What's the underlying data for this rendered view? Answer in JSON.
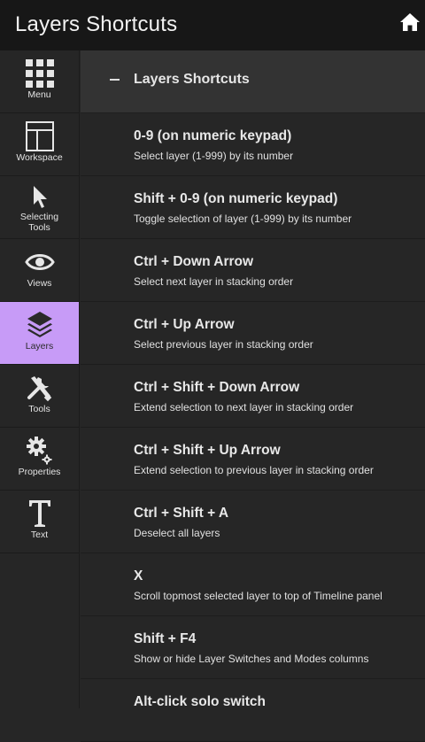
{
  "header": {
    "title": "Layers Shortcuts",
    "home_icon": "home-icon"
  },
  "sidebar": {
    "items": [
      {
        "label": "Menu",
        "icon": "grid-icon",
        "active": false
      },
      {
        "label": "Workspace",
        "icon": "workspace-icon",
        "active": false
      },
      {
        "label": "Selecting Tools",
        "icon": "pointer-icon",
        "active": false
      },
      {
        "label": "Views",
        "icon": "eye-icon",
        "active": false
      },
      {
        "label": "Layers",
        "icon": "layers-icon",
        "active": true
      },
      {
        "label": "Tools",
        "icon": "tools-icon",
        "active": false
      },
      {
        "label": "Properties",
        "icon": "gears-icon",
        "active": false
      },
      {
        "label": "Text",
        "icon": "text-icon",
        "active": false
      }
    ]
  },
  "section": {
    "title": "Layers Shortcuts"
  },
  "shortcuts": [
    {
      "key": "0-9 (on numeric keypad)",
      "desc": "Select layer (1-999) by its number"
    },
    {
      "key": "Shift + 0-9 (on numeric keypad)",
      "desc": "Toggle selection of layer (1-999) by its number"
    },
    {
      "key": "Ctrl + Down Arrow",
      "desc": "Select next layer in stacking order"
    },
    {
      "key": "Ctrl + Up Arrow",
      "desc": "Select previous layer in stacking order"
    },
    {
      "key": "Ctrl + Shift + Down Arrow",
      "desc": "Extend selection to next layer in stacking order"
    },
    {
      "key": "Ctrl + Shift + Up Arrow",
      "desc": "Extend selection to previous layer in stacking order"
    },
    {
      "key": "Ctrl + Shift + A",
      "desc": "Deselect all layers"
    },
    {
      "key": "X",
      "desc": "Scroll topmost selected layer to top of Timeline panel"
    },
    {
      "key": "Shift + F4",
      "desc": "Show or hide Layer Switches and Modes columns"
    },
    {
      "key": "Alt-click solo switch",
      "desc": ""
    }
  ],
  "colors": {
    "accent": "#c79bf7",
    "background": "#262626",
    "topbar": "#171717",
    "section": "#333333"
  }
}
